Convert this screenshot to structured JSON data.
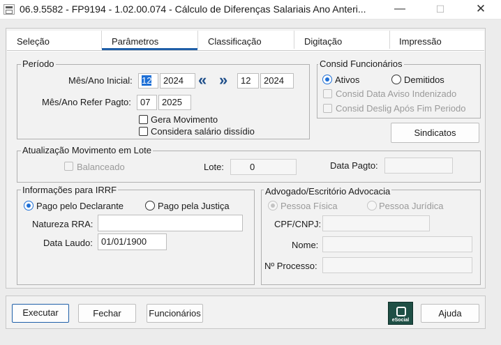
{
  "window": {
    "title": "06.9.5582 - FP9194 - 1.02.00.074 - Cálculo de Diferenças Salariais Ano Anteri...",
    "minimize": "—",
    "maximize": "☐",
    "close": "✕"
  },
  "tabs": [
    {
      "label": "Seleção"
    },
    {
      "label": "Parâmetros",
      "active": true
    },
    {
      "label": "Classificação"
    },
    {
      "label": "Digitação"
    },
    {
      "label": "Impressão"
    }
  ],
  "periodo": {
    "legend": "Período",
    "mes_ano_inicial_label": "Mês/Ano Inicial:",
    "mes_inicial": "12",
    "ano_inicial": "2024",
    "nav_prev": "«",
    "nav_next": "»",
    "mes_final": "12",
    "ano_final": "2024",
    "mes_ano_refer_label": "Mês/Ano Refer Pagto:",
    "mes_refer": "07",
    "ano_refer": "2025",
    "gera_movimento": "Gera Movimento",
    "considera_dissidio": "Considera salário dissídio"
  },
  "consid": {
    "legend": "Consid Funcionários",
    "ativos": "Ativos",
    "demitidos": "Demitidos",
    "aviso_indenizado": "Consid Data Aviso Indenizado",
    "deslig_fim_periodo": "Consid Deslig Após Fim Periodo",
    "sindicatos": "Sindicatos"
  },
  "atualizacao": {
    "legend": "Atualização Movimento em Lote",
    "balanceado": "Balanceado",
    "lote_label": "Lote:",
    "lote_value": "0",
    "data_pagto_label": "Data Pagto:",
    "data_pagto_value": ""
  },
  "irrf": {
    "legend": "Informações para IRRF",
    "pago_declarante": "Pago pelo Declarante",
    "pago_justica": "Pago pela Justiça",
    "natureza_label": "Natureza RRA:",
    "natureza_value": "",
    "data_laudo_label": "Data Laudo:",
    "data_laudo_value": "01/01/1900"
  },
  "advogado": {
    "legend": "Advogado/Escritório Advocacia",
    "pessoa_fisica": "Pessoa Física",
    "pessoa_juridica": "Pessoa Jurídica",
    "cpf_label": "CPF/CNPJ:",
    "nome_label": "Nome:",
    "processo_label": "Nº Processo:"
  },
  "buttons": {
    "executar": "Executar",
    "fechar": "Fechar",
    "funcionarios": "Funcionários",
    "esocial": "eSocial",
    "ajuda": "Ajuda"
  },
  "colors": {
    "accent": "#1f5fa8",
    "selection": "#1d6fd6",
    "esocial": "#1f4f45"
  }
}
